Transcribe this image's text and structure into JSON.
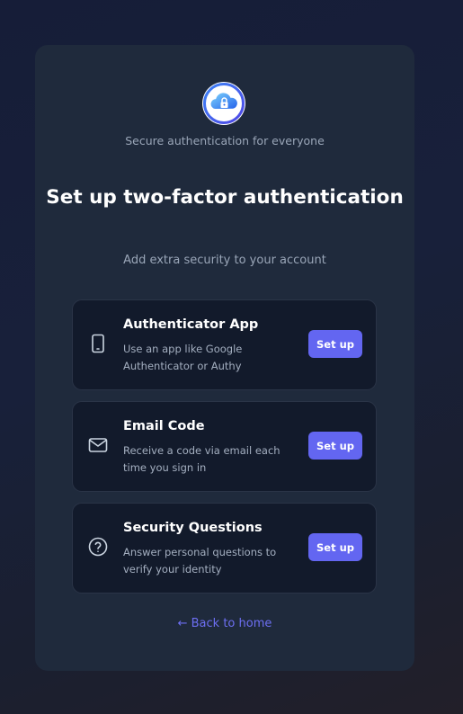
{
  "brand": {
    "logo_icon": "cloud-lock-icon",
    "tagline": "Secure authentication for everyone"
  },
  "header": {
    "title": "Set up two-factor authentication",
    "subtitle": "Add extra security to your account"
  },
  "options": [
    {
      "icon": "smartphone-icon",
      "title": "Authenticator App",
      "description": "Use an app like Google Authenticator or Authy",
      "button_label": "Set up"
    },
    {
      "icon": "mail-icon",
      "title": "Email Code",
      "description": "Receive a code via email each time you sign in",
      "button_label": "Set up"
    },
    {
      "icon": "help-circle-icon",
      "title": "Security Questions",
      "description": "Answer personal questions to verify your identity",
      "button_label": "Set up"
    }
  ],
  "footer": {
    "back_link": "← Back to home"
  },
  "colors": {
    "accent": "#6366f1",
    "card_bg": "#1f2a3c",
    "option_bg": "#121a2b",
    "link": "#6d6ff2"
  }
}
